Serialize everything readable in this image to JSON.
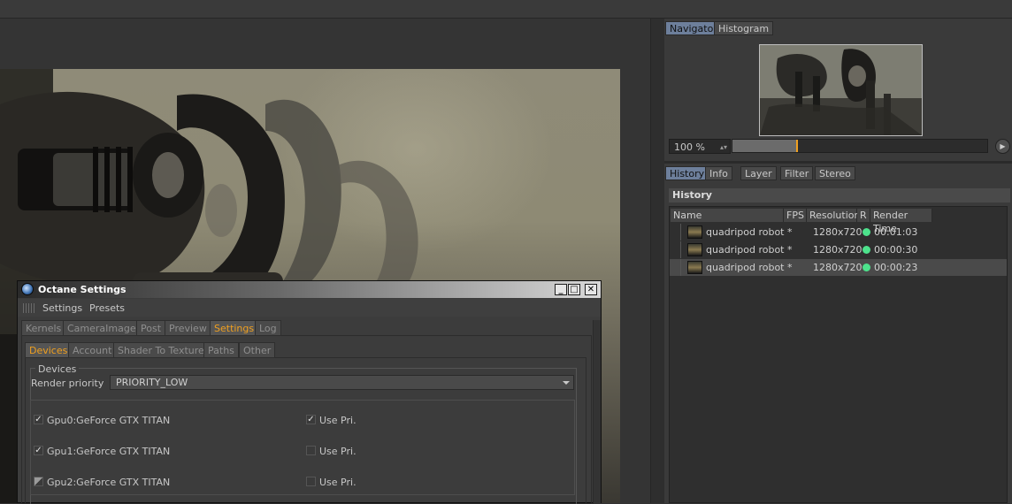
{
  "navigator": {
    "tabs": [
      {
        "label": "Navigator",
        "active": true
      },
      {
        "label": "Histogram",
        "active": false
      }
    ],
    "zoom_value": "100 %",
    "zoom_slider_fraction": 0.25
  },
  "history_panel": {
    "tabs": [
      {
        "label": "History",
        "active": true
      },
      {
        "label": "Info",
        "active": false
      },
      {
        "label": "Layer",
        "active": false
      },
      {
        "label": "Filter",
        "active": false
      },
      {
        "label": "Stereo",
        "active": false
      }
    ],
    "header": "History",
    "columns": [
      "Name",
      "FPS",
      "Resolution",
      "R",
      "Render Time"
    ],
    "rows": [
      {
        "name": "quadripod robot *",
        "fps": "",
        "resolution": "1280x720",
        "status_color": "#4de28c",
        "render_time": "00:01:03",
        "selected": false
      },
      {
        "name": "quadripod robot *",
        "fps": "",
        "resolution": "1280x720",
        "status_color": "#4de28c",
        "render_time": "00:00:30",
        "selected": false
      },
      {
        "name": "quadripod robot *",
        "fps": "",
        "resolution": "1280x720",
        "status_color": "#4de28c",
        "render_time": "00:00:23",
        "selected": true
      }
    ]
  },
  "octane_dialog": {
    "title": "Octane Settings",
    "window_buttons": {
      "minimize": "_",
      "maximize": "□",
      "close": "✕"
    },
    "menu": [
      "Settings",
      "Presets"
    ],
    "main_tabs": [
      {
        "label": "Kernels",
        "active": false
      },
      {
        "label": "CameraImager",
        "active": false
      },
      {
        "label": "Post",
        "active": false
      },
      {
        "label": "Preview",
        "active": false
      },
      {
        "label": "Settings",
        "active": true
      },
      {
        "label": "Log",
        "active": false
      }
    ],
    "sub_tabs": [
      {
        "label": "Devices",
        "active": true
      },
      {
        "label": "Account",
        "active": false
      },
      {
        "label": "Shader To Texture",
        "active": false
      },
      {
        "label": "Paths",
        "active": false
      },
      {
        "label": "Other",
        "active": false
      }
    ],
    "devices_group_label": "Devices",
    "render_priority_label": "Render priority",
    "render_priority_value": "PRIORITY_LOW",
    "gpus": [
      {
        "label": "Gpu0:GeForce GTX TITAN",
        "enabled": "checked",
        "use_pri_label": "Use Pri.",
        "use_pri": true
      },
      {
        "label": "Gpu1:GeForce GTX TITAN",
        "enabled": "checked",
        "use_pri_label": "Use Pri.",
        "use_pri": false
      },
      {
        "label": "Gpu2:GeForce GTX TITAN",
        "enabled": "partial",
        "use_pri_label": "Use Pri.",
        "use_pri": false
      }
    ]
  },
  "colors": {
    "active_tab_orange": "#f0a020",
    "active_tab_blue": "#6d7f9b",
    "status_green": "#4de28c"
  }
}
